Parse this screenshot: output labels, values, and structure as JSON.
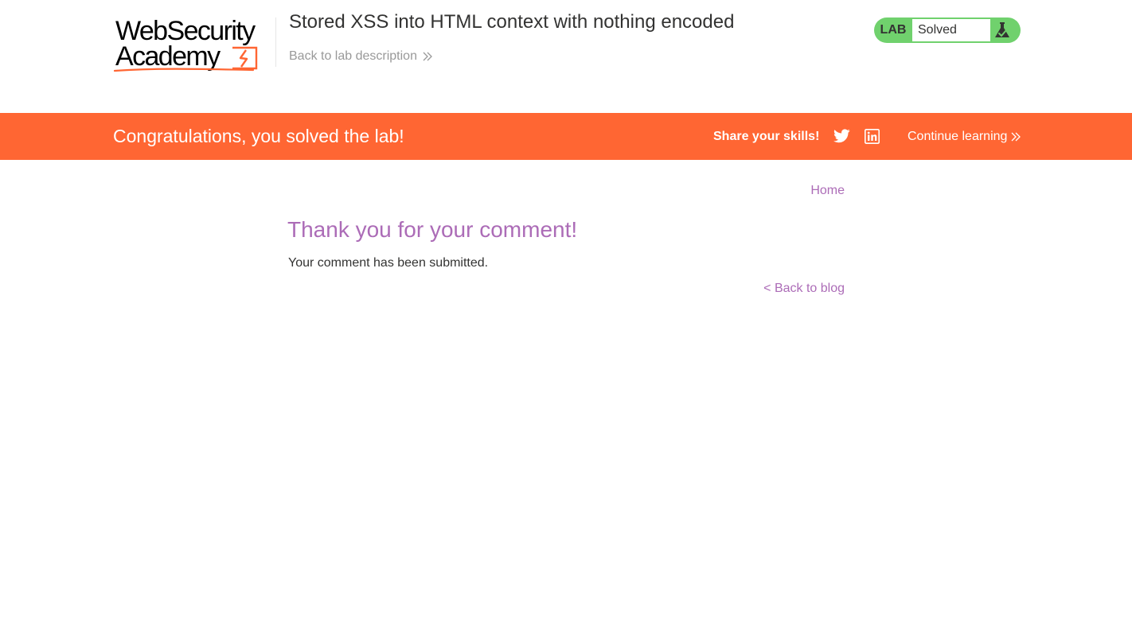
{
  "header": {
    "logo_line1": "WebSecurity",
    "logo_line2": "Academy",
    "lab_title": "Stored XSS into HTML context with nothing encoded",
    "back_to_description": "Back to lab description",
    "status": {
      "lab_label": "LAB",
      "value": "Solved",
      "icon": "flask-icon"
    }
  },
  "banner": {
    "message": "Congratulations, you solved the lab!",
    "share_label": "Share your skills!",
    "share_icons": [
      "twitter-icon",
      "linkedin-icon"
    ],
    "continue_label": "Continue learning"
  },
  "main": {
    "nav_home": "Home",
    "heading": "Thank you for your comment!",
    "message": "Your comment has been submitted.",
    "back_to_blog": "< Back to blog"
  },
  "colors": {
    "brand_orange": "#ff6633",
    "link_purple": "#ac6cb7",
    "status_green": "#70d16d",
    "text_dark": "#333332",
    "muted_gray": "#999999"
  }
}
